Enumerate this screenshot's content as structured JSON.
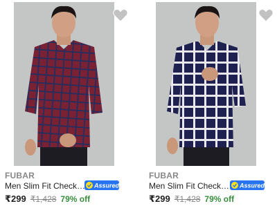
{
  "products": [
    {
      "brand": "FUBAR",
      "title": "Men Slim Fit Checkered Casual Shirt",
      "badge": "Assured",
      "price": "₹299",
      "mrp": "₹1,428",
      "discount": "79% off",
      "shirt_color": "#7a2233",
      "check_color": "#2a2d5c",
      "wishlist_icon": "heart-icon"
    },
    {
      "brand": "FUBAR",
      "title": "Men Slim Fit Checkered Casual Shirt",
      "badge": "Assured",
      "price": "₹299",
      "mrp": "₹1,428",
      "discount": "79% off",
      "shirt_color": "#1f2150",
      "check_color": "#e8e8ee",
      "wishlist_icon": "heart-icon"
    }
  ]
}
